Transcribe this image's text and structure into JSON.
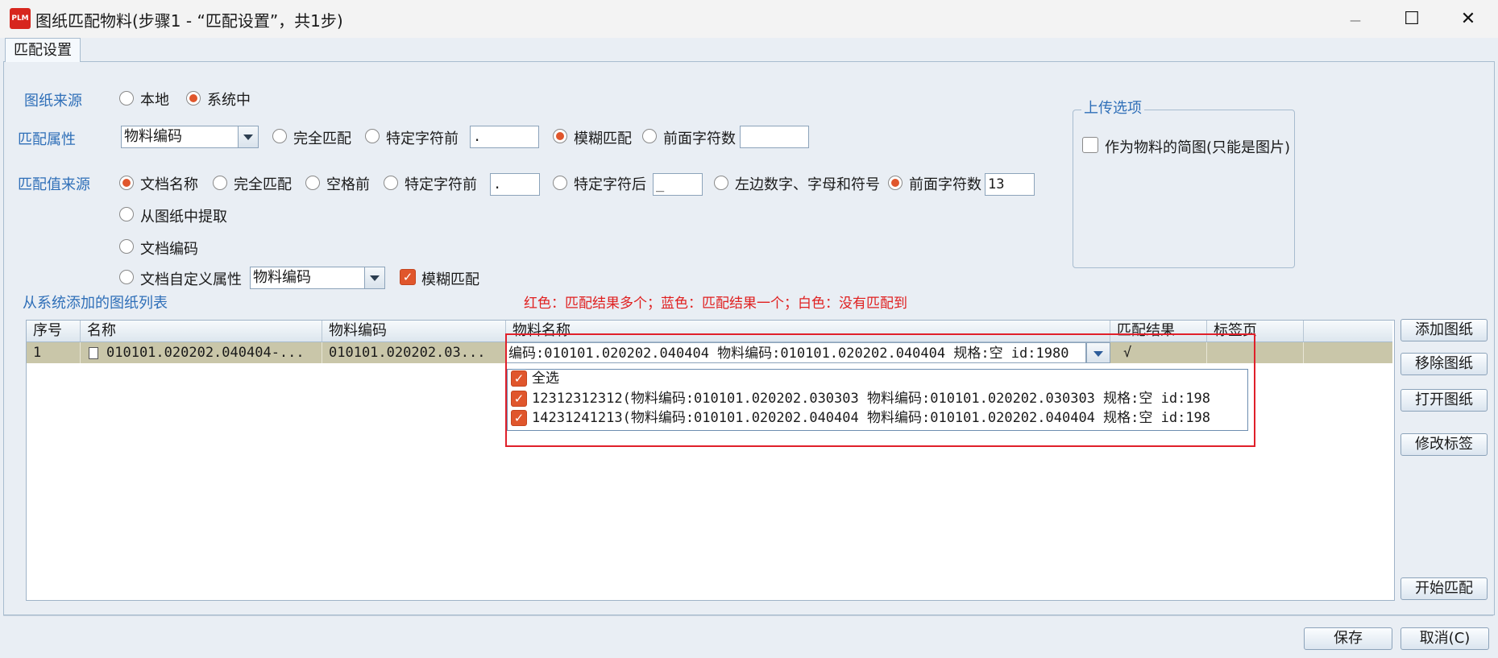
{
  "window": {
    "title": "图纸匹配物料(步骤1 - “匹配设置”，共1步)",
    "logo_text": "PLM",
    "minimize_glyph": "—",
    "maximize_glyph": "☐",
    "close_glyph": "✕"
  },
  "tabs": [
    {
      "label": "匹配设置"
    }
  ],
  "source": {
    "label": "图纸来源",
    "options": [
      {
        "label": "本地",
        "selected": false
      },
      {
        "label": "系统中",
        "selected": true
      }
    ]
  },
  "match_attr": {
    "label": "匹配属性",
    "combo_value": "物料编码",
    "opt_exact": "完全匹配",
    "opt_before_char": "特定字符前",
    "before_char_value": ".",
    "opt_fuzzy": "模糊匹配",
    "opt_prefix_count": "前面字符数",
    "prefix_count_value": "",
    "selected": "模糊匹配"
  },
  "match_value_source": {
    "label": "匹配值来源",
    "opt_doc_name": "文档名称",
    "opt_exact": "完全匹配",
    "opt_before_space": "空格前",
    "opt_before_char": "特定字符前",
    "before_char_value": ".",
    "opt_after_char": "特定字符后",
    "after_char_value": "_",
    "opt_left_chars": "左边数字、字母和符号",
    "opt_prefix_count": "前面字符数",
    "prefix_count_value": "13",
    "opt_from_drawing": "从图纸中提取",
    "opt_doc_code": "文档编码",
    "opt_custom_attr": "文档自定义属性",
    "custom_attr_value": "物料编码",
    "fuzzy_label": "模糊匹配",
    "fuzzy_checked": true
  },
  "upload": {
    "title": "上传选项",
    "as_thumbnail": "作为物料的简图(只能是图片)"
  },
  "list": {
    "title": "从系统添加的图纸列表",
    "hint": "红色：匹配结果多个；蓝色：匹配结果一个；白色：没有匹配到",
    "columns": [
      "序号",
      "名称",
      "物料编码",
      "物料名称",
      "匹配结果",
      "标签页"
    ],
    "rows": [
      {
        "index": "1",
        "name": "010101.020202.040404-...",
        "code": "010101.020202.03...",
        "material": "编码:010101.020202.040404 物料编码:010101.020202.040404 规格:空 id:1980",
        "result": "√",
        "tab": ""
      }
    ],
    "dropdown": {
      "items": [
        {
          "label": "全选",
          "checked": true
        },
        {
          "label": "12312312312(物料编码:010101.020202.030303 物料编码:010101.020202.030303 规格:空 id:198",
          "checked": true
        },
        {
          "label": "14231241213(物料编码:010101.020202.040404 物料编码:010101.020202.040404 规格:空 id:198",
          "checked": true
        }
      ]
    }
  },
  "side_buttons": {
    "add": "添加图纸",
    "remove": "移除图纸",
    "open": "打开图纸",
    "edit_tag": "修改标签",
    "start": "开始匹配"
  },
  "footer": {
    "save": "保存",
    "cancel": "取消(C)"
  },
  "colors": {
    "accent": "#e0562c",
    "label_blue": "#2f6fb8",
    "hint_red": "#e02020",
    "row_highlight": "#c9c6a9"
  }
}
